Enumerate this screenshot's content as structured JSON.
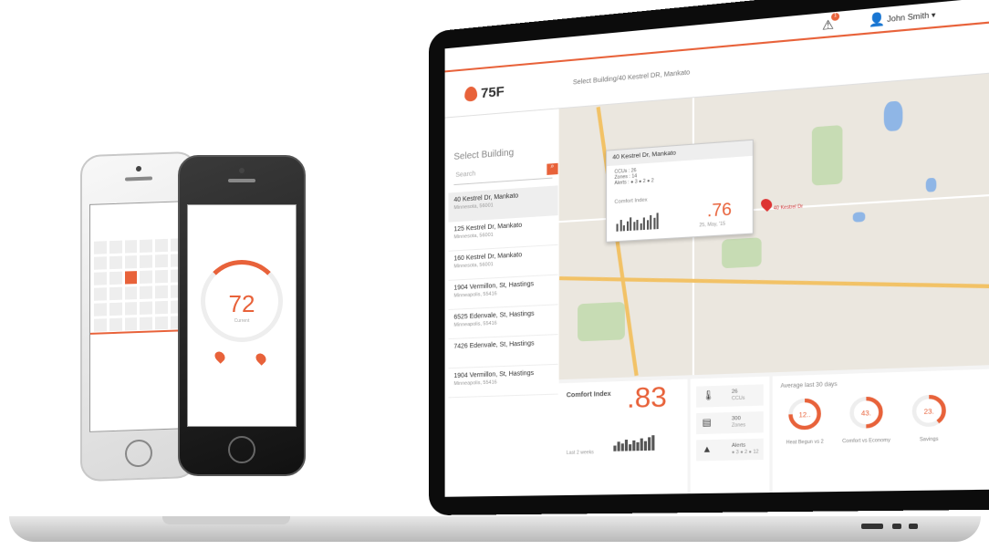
{
  "header": {
    "breadcrumb": "Select Building/40 Kestrel DR, Mankato",
    "user_name": "John Smith ▾",
    "alert_count": "1",
    "logo": "75F"
  },
  "sidebar": {
    "title": "Select Building",
    "search_placeholder": "Search",
    "items": [
      {
        "name": "40 Kestrel Dr, Mankato",
        "city": "Minnesota, 56001"
      },
      {
        "name": "125 Kestrel Dr, Mankato",
        "city": "Minnesota, 56001"
      },
      {
        "name": "160 Kestrel Dr, Mankato",
        "city": "Minnesota, 56001"
      },
      {
        "name": "1904 Vermillon, St, Hastings",
        "city": "Minneapolis, 55416"
      },
      {
        "name": "6525 Edenvale, St, Hastings",
        "city": "Minneapolis, 55416"
      },
      {
        "name": "7426 Edenvale, St, Hastings",
        "city": ""
      },
      {
        "name": "1904 Vermillon, St, Hastings",
        "city": "Minneapolis, 55416"
      }
    ]
  },
  "popup": {
    "title": "40 Kestrel Dr, Mankato",
    "ccus": "CCUs : 26",
    "zones": "Zones : 14",
    "alerts": "Alerts :  ● 3  ● 2  ● 2",
    "comfort_label": "Comfort Index",
    "comfort_value": ".76",
    "date": "25, May, '15",
    "pin_label": "40 Kestrel Dr"
  },
  "comfort": {
    "title": "Comfort Index",
    "value": ".83",
    "period": "Last 2 weeks"
  },
  "stats": [
    {
      "value": "26",
      "label": "CCUs",
      "icon": "thermostat-icon"
    },
    {
      "value": "300",
      "label": "Zones",
      "icon": "zones-icon"
    },
    {
      "value": "Alerts",
      "label": "● 3  ● 2  ● 12",
      "icon": "warning-icon"
    }
  ],
  "averages": {
    "title": "Average last 30 days",
    "items": [
      {
        "value": "12..",
        "label": "Heat Begun vs 2",
        "fraction": 0.75
      },
      {
        "value": "43.",
        "label": "Comfort vs Economy",
        "fraction": 0.5
      },
      {
        "value": "23.",
        "label": "Savings",
        "fraction": 0.4
      }
    ]
  },
  "phone_black": {
    "temperature": "72",
    "mode": "Current"
  },
  "colors": {
    "accent": "#e8623a",
    "map_bg": "#ebe7df"
  }
}
